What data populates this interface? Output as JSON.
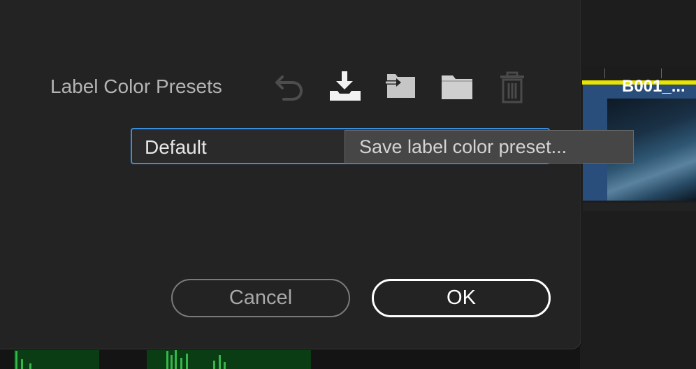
{
  "dialog": {
    "section_label": "Label Color Presets",
    "toolbar": {
      "undo_icon": "undo-icon",
      "import_icon": "import-download-icon",
      "export_icon": "export-preset-icon",
      "folder_icon": "folder-icon",
      "delete_icon": "trash-icon"
    },
    "preset_select": {
      "value": "Default"
    },
    "tooltip": "Save label color preset...",
    "buttons": {
      "cancel": "Cancel",
      "ok": "OK"
    }
  },
  "timeline": {
    "clip_name": "B001_...",
    "playbar_color": "#e8e400",
    "clip_color": "#2a4e7c"
  },
  "colors": {
    "accent": "#3b8ddd",
    "dialog_bg": "#232323",
    "audio_wave": "#36b64a"
  }
}
